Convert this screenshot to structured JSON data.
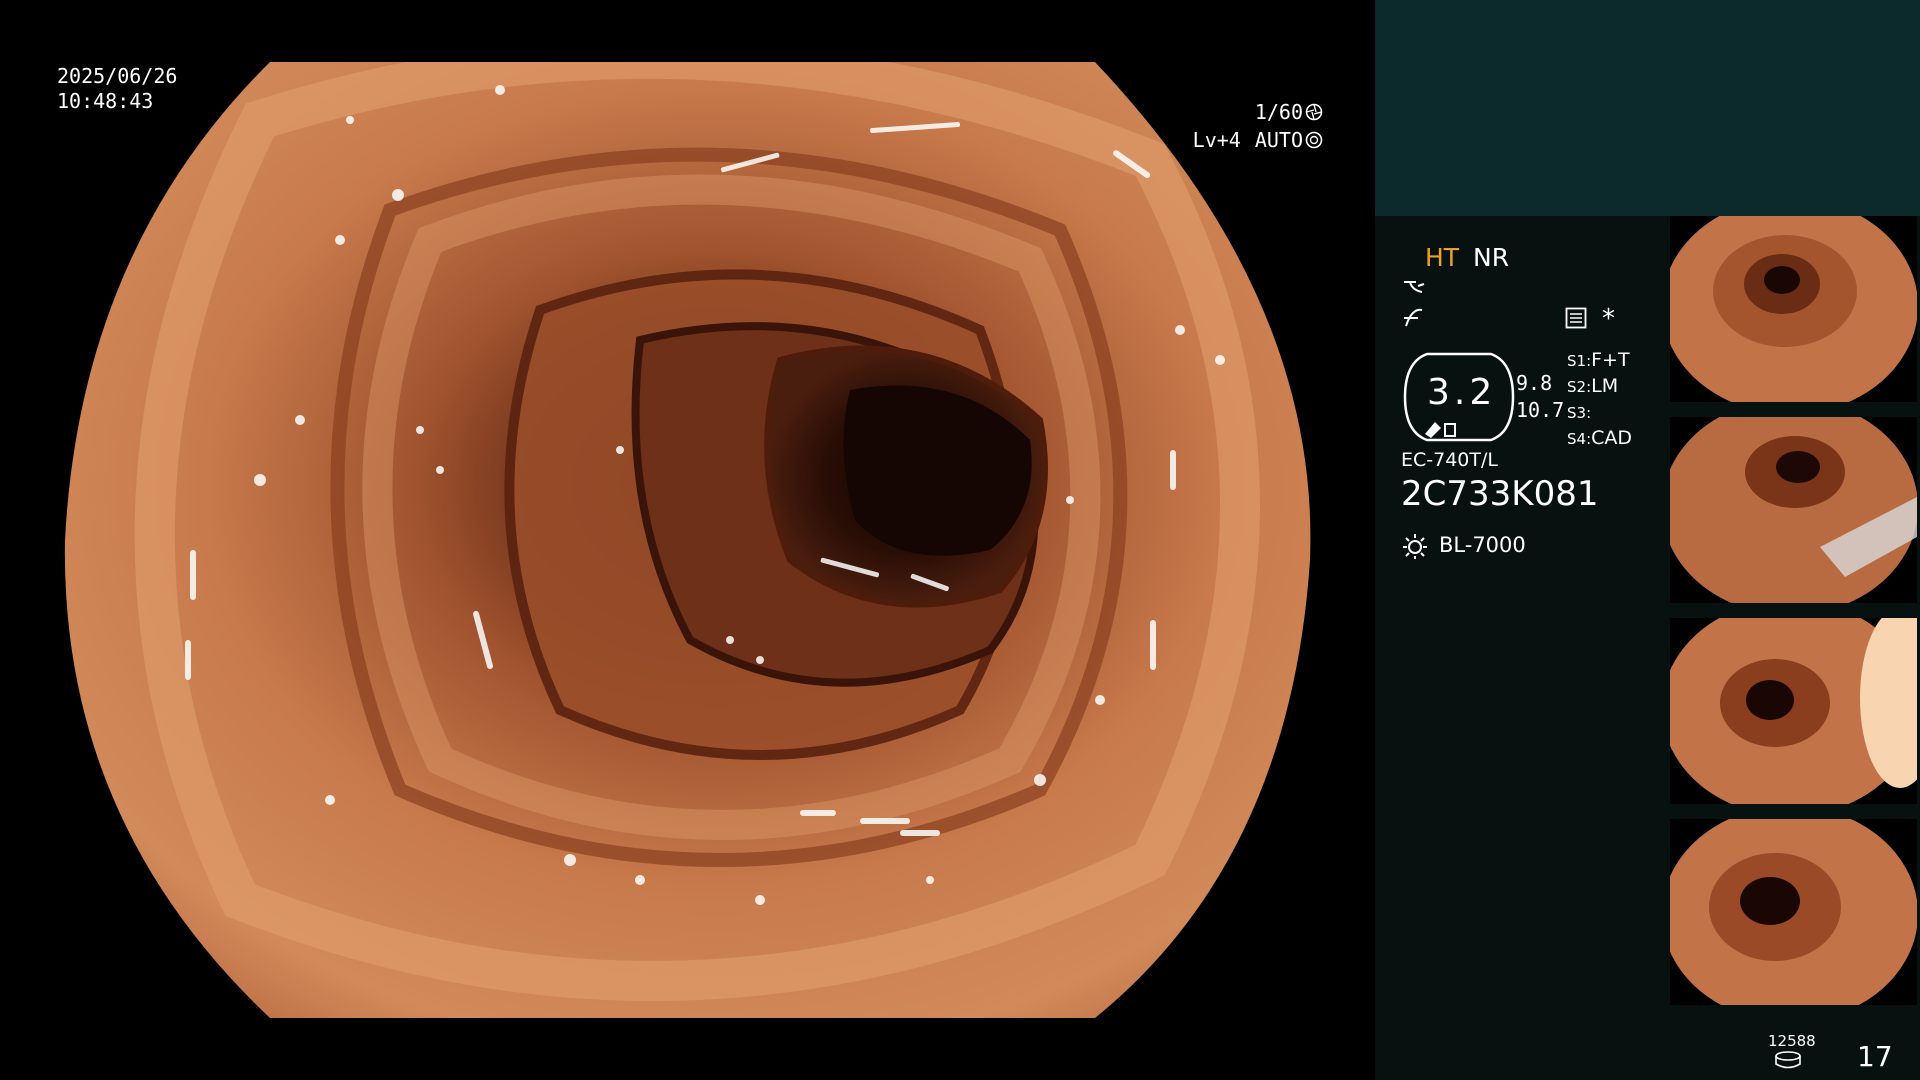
{
  "endoscope_view": {
    "date": "2025/06/26",
    "time": "10:48:43",
    "shutter": "1/60",
    "brightness": "Lv+4",
    "iris_mode": "AUTO"
  },
  "side_panel": {
    "mode_ht": "HT",
    "mode_nr": "NR",
    "enhance_value": "3.2",
    "small_value_1": "9.8",
    "small_value_2": "10.7",
    "switches": [
      {
        "key": "S1:",
        "value": "F+T"
      },
      {
        "key": "S2:",
        "value": "LM"
      },
      {
        "key": "S3:",
        "value": ""
      },
      {
        "key": "S4:",
        "value": "CAD"
      }
    ],
    "asterisk": "*",
    "scope_model": "EC-740T/L",
    "scope_serial": "2C733K081",
    "light_source": "BL-7000",
    "storage_count": "12588",
    "image_count": "17"
  },
  "colors": {
    "panel_dark": "#071210",
    "panel_header": "#0c2a2b",
    "ht_accent": "#f0a020"
  }
}
